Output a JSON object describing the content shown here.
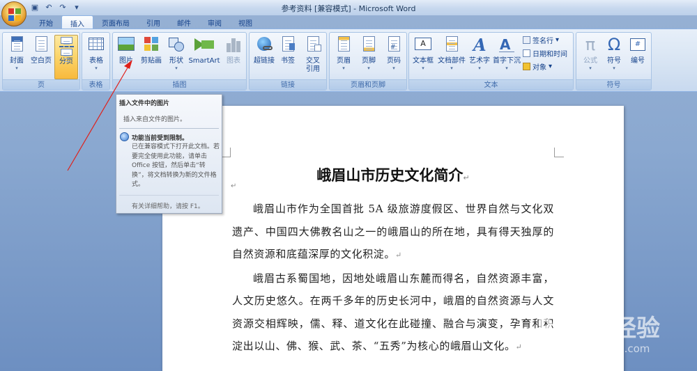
{
  "window": {
    "title": "参考资料 [兼容模式] - Microsoft Word"
  },
  "tabs": [
    {
      "label": "开始"
    },
    {
      "label": "插入",
      "active": true
    },
    {
      "label": "页面布局"
    },
    {
      "label": "引用"
    },
    {
      "label": "邮件"
    },
    {
      "label": "审阅"
    },
    {
      "label": "视图"
    }
  ],
  "ribbon": {
    "groups": {
      "pages": {
        "label": "页",
        "buttons": [
          "封面",
          "空白页",
          "分页"
        ]
      },
      "tables": {
        "label": "表格",
        "buttons": [
          "表格"
        ]
      },
      "illustrations": {
        "label": "插图",
        "buttons": [
          "图片",
          "剪贴画",
          "形状",
          "SmartArt",
          "图表"
        ]
      },
      "links": {
        "label": "链接",
        "buttons": [
          "超链接",
          "书签",
          "交叉",
          "引用"
        ]
      },
      "header_footer": {
        "label": "页眉和页脚",
        "buttons": [
          "页眉",
          "页脚",
          "页码"
        ]
      },
      "text": {
        "label": "文本",
        "buttons": [
          "文本框",
          "文档部件",
          "艺术字",
          "首字下沉"
        ],
        "small": [
          "签名行",
          "日期和时间",
          "对象"
        ]
      },
      "symbols": {
        "label": "符号",
        "buttons": [
          "公式",
          "符号",
          "编号"
        ]
      }
    }
  },
  "tooltip": {
    "title": "插入文件中的图片",
    "desc": "插入来自文件的图片。",
    "warning_title": "功能当前受到限制。",
    "warning_body": "已在兼容模式下打开此文档。若要完全使用此功能，请单击 Office 按钮，然后单击“转换”，将文档转换为新的文件格式。",
    "help": "有关详细帮助，请按 F1。"
  },
  "document": {
    "title": "峨眉山市历史文化简介",
    "paragraphs": [
      "峨眉山市作为全国首批 5A 级旅游度假区、世界自然与文化双遗产、中国四大佛教名山之一的峨眉山的所在地，具有得天独厚的自然资源和底蕴深厚的文化积淀。",
      "峨眉古系蜀国地，因地处峨眉山东麓而得名，自然资源丰富，人文历史悠久。在两千多年的历史长河中，峨眉的自然资源与人文资源交相辉映，儒、释、道文化在此碰撞、融合与演变，孕育和积淀出以山、佛、猴、武、茶、“五秀”为核心的峨眉山文化。"
    ]
  },
  "watermark": {
    "text": "Baidu经验",
    "url": "jingyan.baidu.com"
  }
}
